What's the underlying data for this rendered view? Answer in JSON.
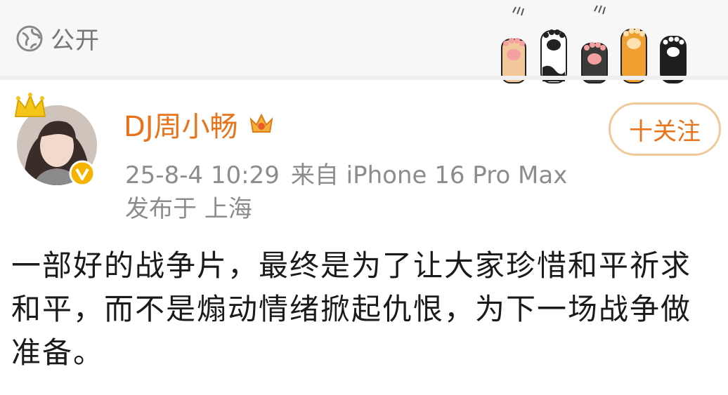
{
  "header": {
    "privacy_label": "公开",
    "privacy_icon": "globe-icon",
    "decoration_icon": "cat-paws-icon"
  },
  "post": {
    "author": {
      "name": "DJ周小畅",
      "name_color": "#e8731a",
      "vip_badge_icon": "vip-crown-badge-icon",
      "verified_icon": "verified-v-icon"
    },
    "meta": {
      "timestamp": "25-8-4 10:29",
      "source": "来自 iPhone 16 Pro Max",
      "location": "发布于 上海"
    },
    "follow_label": "十关注",
    "text": "一部好的战争片，最终是为了让大家珍惜和平祈求和平，而不是煽动情绪掀起仇恨，为下一场战争做准备。"
  }
}
